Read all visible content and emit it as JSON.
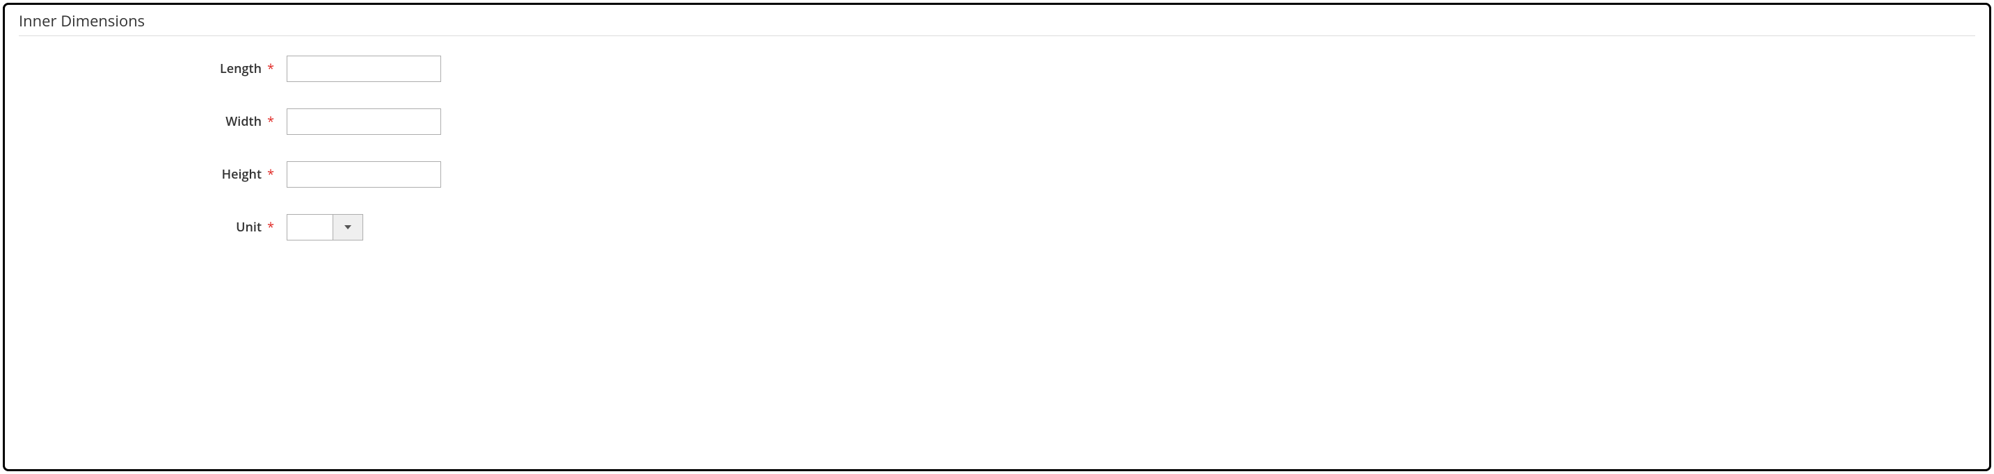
{
  "section": {
    "title": "Inner Dimensions"
  },
  "fields": {
    "length": {
      "label": "Length",
      "required": "*",
      "value": ""
    },
    "width": {
      "label": "Width",
      "required": "*",
      "value": ""
    },
    "height": {
      "label": "Height",
      "required": "*",
      "value": ""
    },
    "unit": {
      "label": "Unit",
      "required": "*",
      "value": ""
    }
  }
}
